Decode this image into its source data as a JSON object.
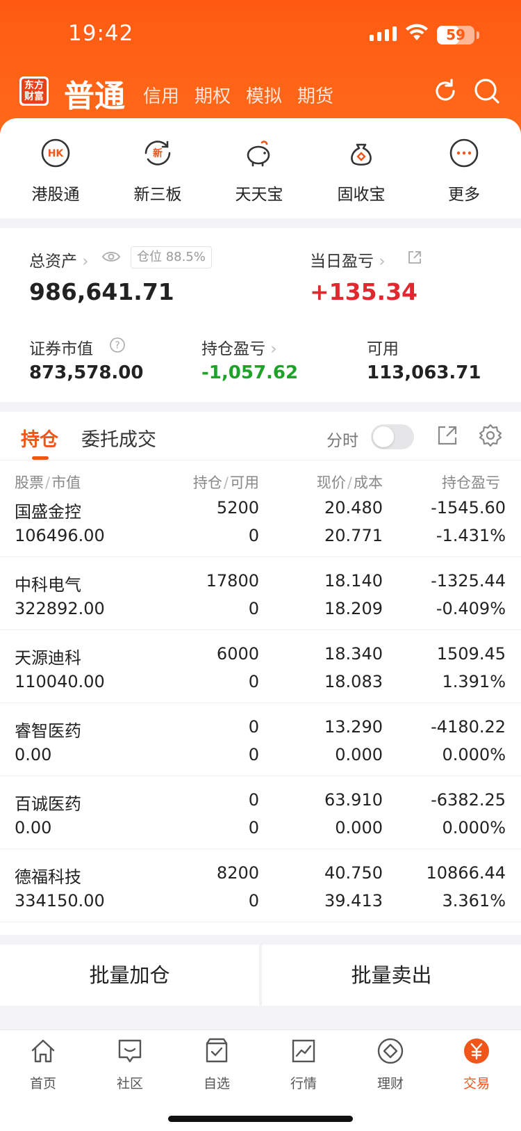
{
  "status": {
    "time": "19:42",
    "battery": "59",
    "battery_level": 0.59
  },
  "header": {
    "logo": "东方财富",
    "account_main": "普通",
    "account_tabs": [
      "信用",
      "期权",
      "模拟",
      "期货"
    ]
  },
  "quick_actions": [
    {
      "label": "港股通",
      "icon_text": "HK",
      "icon": "hk-icon"
    },
    {
      "label": "新三板",
      "icon_text": "新",
      "icon": "refresh-new-icon"
    },
    {
      "label": "天天宝",
      "icon": "piggy-bank-icon"
    },
    {
      "label": "固收宝",
      "icon": "money-bag-icon"
    },
    {
      "label": "更多",
      "icon": "more-dots-icon"
    }
  ],
  "assets": {
    "total_label": "总资产",
    "position_tag": "仓位 88.5%",
    "total_value": "986,641.71",
    "daily_pnl_label": "当日盈亏",
    "daily_pnl_value": "+135.34",
    "market_value_label": "证券市值",
    "market_value": "873,578.00",
    "holding_pnl_label": "持仓盈亏",
    "holding_pnl_value": "-1,057.62",
    "available_label": "可用",
    "available_value": "113,063.71"
  },
  "holdings": {
    "tab_holdings": "持仓",
    "tab_orders": "委托成交",
    "fenshi_label": "分时",
    "columns": {
      "c1a": "股票",
      "c1b": "市值",
      "c2a": "持仓",
      "c2b": "可用",
      "c3a": "现价",
      "c3b": "成本",
      "c4": "持仓盈亏"
    },
    "rows": [
      {
        "name": "国盛金控",
        "market_value": "106496.00",
        "position": "5200",
        "available": "0",
        "price": "20.480",
        "cost": "20.771",
        "pnl": "-1545.60",
        "pnl_pct": "-1.431%",
        "dir": "down"
      },
      {
        "name": "中科电气",
        "market_value": "322892.00",
        "position": "17800",
        "available": "0",
        "price": "18.140",
        "cost": "18.209",
        "pnl": "-1325.44",
        "pnl_pct": "-0.409%",
        "dir": "down"
      },
      {
        "name": "天源迪科",
        "market_value": "110040.00",
        "position": "6000",
        "available": "0",
        "price": "18.340",
        "cost": "18.083",
        "pnl": "1509.45",
        "pnl_pct": "1.391%",
        "dir": "up"
      },
      {
        "name": "睿智医药",
        "market_value": "0.00",
        "position": "0",
        "available": "0",
        "price": "13.290",
        "cost": "0.000",
        "pnl": "-4180.22",
        "pnl_pct": "0.000%",
        "dir": "down"
      },
      {
        "name": "百诚医药",
        "market_value": "0.00",
        "position": "0",
        "available": "0",
        "price": "63.910",
        "cost": "0.000",
        "pnl": "-6382.25",
        "pnl_pct": "0.000%",
        "dir": "down"
      },
      {
        "name": "德福科技",
        "market_value": "334150.00",
        "position": "8200",
        "available": "0",
        "price": "40.750",
        "cost": "39.413",
        "pnl": "10866.44",
        "pnl_pct": "3.361%",
        "dir": "up"
      }
    ]
  },
  "batch": {
    "buy": "批量加仓",
    "sell": "批量卖出"
  },
  "tabbar": [
    {
      "label": "首页",
      "icon": "home-icon"
    },
    {
      "label": "社区",
      "icon": "chat-icon"
    },
    {
      "label": "自选",
      "icon": "watchlist-icon"
    },
    {
      "label": "行情",
      "icon": "chart-icon"
    },
    {
      "label": "理财",
      "icon": "diamond-icon"
    },
    {
      "label": "交易",
      "icon": "yuan-icon",
      "active": true
    }
  ],
  "colors": {
    "accent": "#f0551a",
    "up": "#e0282e",
    "down": "#1ea328"
  }
}
